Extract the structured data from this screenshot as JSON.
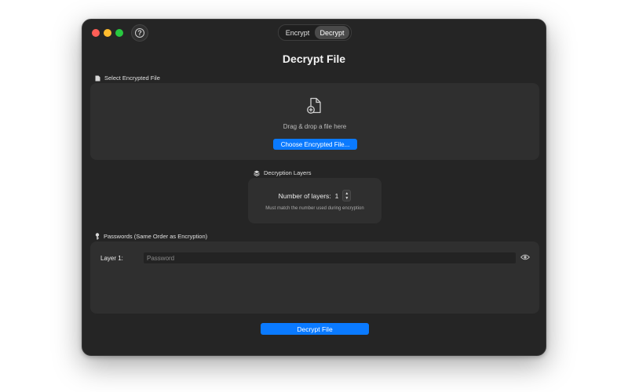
{
  "titlebar": {
    "help_icon": "question-circle-icon",
    "help_glyph": "?",
    "tabs": [
      {
        "label": "Encrypt",
        "active": false
      },
      {
        "label": "Decrypt",
        "active": true
      }
    ]
  },
  "page": {
    "title": "Decrypt File"
  },
  "file_section": {
    "label": "Select Encrypted File",
    "icon": "document-icon",
    "drop_icon": "document-add-icon",
    "drop_text": "Drag & drop a file here",
    "choose_button": "Choose Encrypted File..."
  },
  "layers_section": {
    "label": "Decryption Layers",
    "icon": "stack-icon",
    "count_label": "Number of layers:",
    "count_value": "1",
    "hint": "Must match the number used during encryption"
  },
  "passwords_section": {
    "label": "Passwords (Same Order as Encryption)",
    "icon": "key-icon",
    "rows": [
      {
        "label": "Layer 1:",
        "placeholder": "Password",
        "value": ""
      }
    ]
  },
  "actions": {
    "decrypt_button": "Decrypt File"
  },
  "colors": {
    "accent": "#0a7aff",
    "window_bg": "#252525",
    "panel_bg": "#2f2f2f"
  }
}
